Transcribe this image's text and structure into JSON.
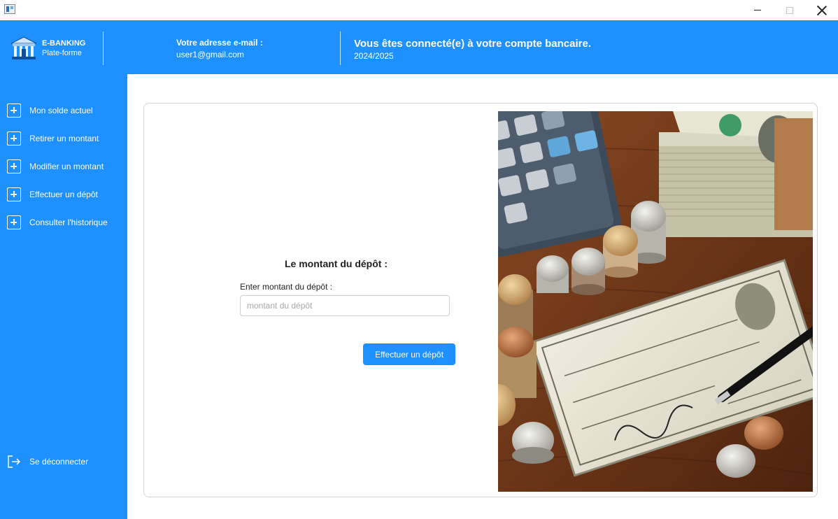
{
  "window": {
    "minimize": "minimize",
    "maximize": "maximize",
    "close": "close"
  },
  "header": {
    "brand_title": "E-BANKING",
    "brand_subtitle": "Plate-forme",
    "email_label": "Votre adresse e-mail :",
    "email_value": "user1@gmail.com",
    "connected_title": "Vous êtes connecté(e) à votre compte bancaire.",
    "year": "2024/2025"
  },
  "sidebar": {
    "items": [
      {
        "label": "Mon solde actuel",
        "icon": "plus-square-icon"
      },
      {
        "label": "Retirer un montant",
        "icon": "plus-square-icon"
      },
      {
        "label": "Modifier un montant",
        "icon": "plus-square-icon"
      },
      {
        "label": "Effectuer un dépôt",
        "icon": "plus-square-icon"
      },
      {
        "label": "Consulter l'historique",
        "icon": "plus-square-icon"
      }
    ],
    "logout_label": "Se déconnecter",
    "logout_icon": "logout-icon"
  },
  "form": {
    "title": "Le montant du dépôt :",
    "input_label": "Enter montant du dépôt :",
    "input_value": "",
    "input_placeholder": "montant du dépôt",
    "button_label": "Effectuer un dépôt"
  },
  "colors": {
    "accent": "#1e90ff",
    "background": "#ffffff"
  }
}
